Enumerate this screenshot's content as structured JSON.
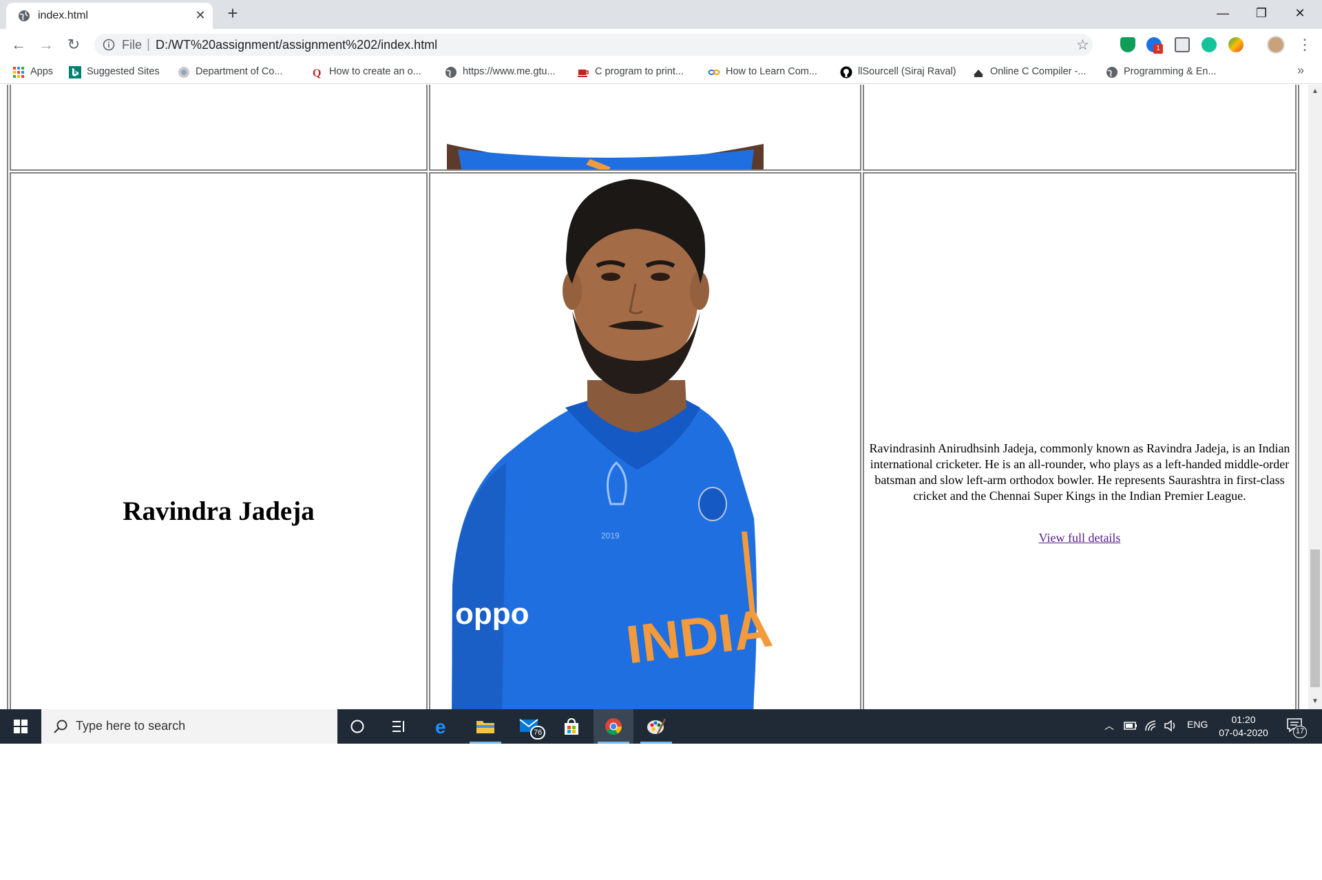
{
  "browser": {
    "tab_title": "index.html",
    "new_tab_symbol": "+",
    "url_scheme": "File",
    "url": "D:/WT%20assignment/assignment%202/index.html",
    "extension_badge": "1"
  },
  "bookmarks": [
    {
      "label": "Apps"
    },
    {
      "label": "Suggested Sites"
    },
    {
      "label": "Department of Co..."
    },
    {
      "label": "How to create an o..."
    },
    {
      "label": "https://www.me.gtu..."
    },
    {
      "label": "C program to print..."
    },
    {
      "label": "How to Learn Com..."
    },
    {
      "label": "llSourcell (Siraj Raval)"
    },
    {
      "label": "Online C Compiler -..."
    },
    {
      "label": "Programming & En..."
    }
  ],
  "page": {
    "player_name": "Ravindra Jadeja",
    "bio": "Ravindrasinh Anirudhsinh Jadeja, commonly known as Ravindra Jadeja, is an Indian international cricketer. He is an all-rounder, who plays as a left-handed middle-order batsman and slow left-arm orthodox bowler. He represents Saurashtra in first-class cricket and the Chennai Super Kings in the Indian Premier League.",
    "link_text": "View full details",
    "jersey_text": "INDIA",
    "sponsor_text": "oppo"
  },
  "taskbar": {
    "search_placeholder": "Type here to search",
    "mail_badge": "76",
    "language": "ENG",
    "time": "01:20",
    "date": "07-04-2020",
    "notification_count": "17"
  },
  "colors": {
    "jersey_blue": "#1f6fe0",
    "jersey_orange": "#f39a3c",
    "link_visited": "#551a8b",
    "taskbar_bg": "#1f2a36"
  }
}
